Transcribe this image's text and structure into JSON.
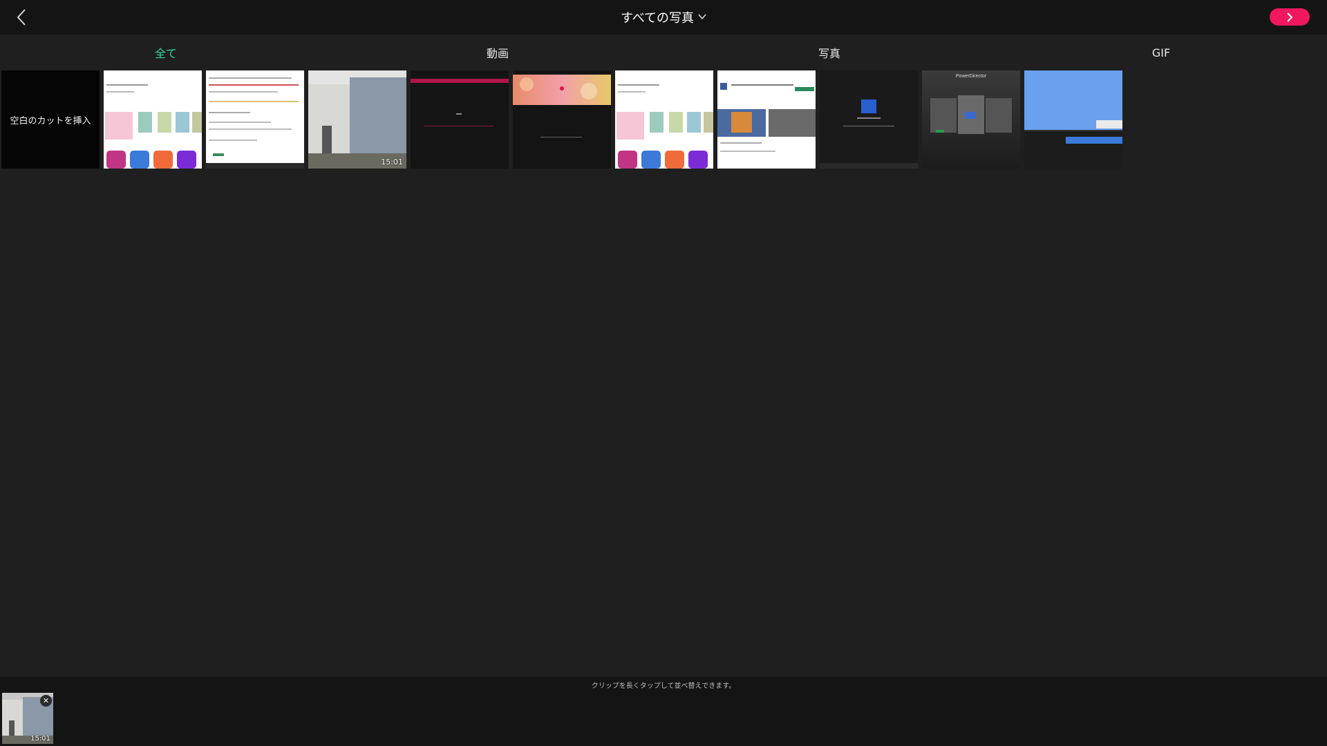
{
  "header": {
    "title": "すべての写真",
    "back_icon": "back-chevron-icon",
    "next_icon": "chevron-right-icon",
    "accent_color": "#f0175e"
  },
  "tabs": [
    {
      "label": "全て",
      "active": true
    },
    {
      "label": "動画",
      "active": false
    },
    {
      "label": "写真",
      "active": false
    },
    {
      "label": "GIF",
      "active": false
    }
  ],
  "active_tab_color": "#2fd8a2",
  "grid": {
    "blank_cut_label": "空白のカットを挿入",
    "items": [
      {
        "kind": "screenshot-apps"
      },
      {
        "kind": "screenshot-document"
      },
      {
        "kind": "video-building",
        "duration": "15:01"
      },
      {
        "kind": "screenshot-dark-red"
      },
      {
        "kind": "screenshot-bokeh"
      },
      {
        "kind": "screenshot-apps"
      },
      {
        "kind": "screenshot-store"
      },
      {
        "kind": "screenshot-splash"
      },
      {
        "kind": "screenshot-powerdirector",
        "caption": "PowerDirector"
      },
      {
        "kind": "screenshot-blue"
      }
    ]
  },
  "bottom": {
    "hint": "クリップを長くタップして並べ替えできます。",
    "selected_clip": {
      "duration": "15:01",
      "remove_icon": "close-icon"
    }
  }
}
